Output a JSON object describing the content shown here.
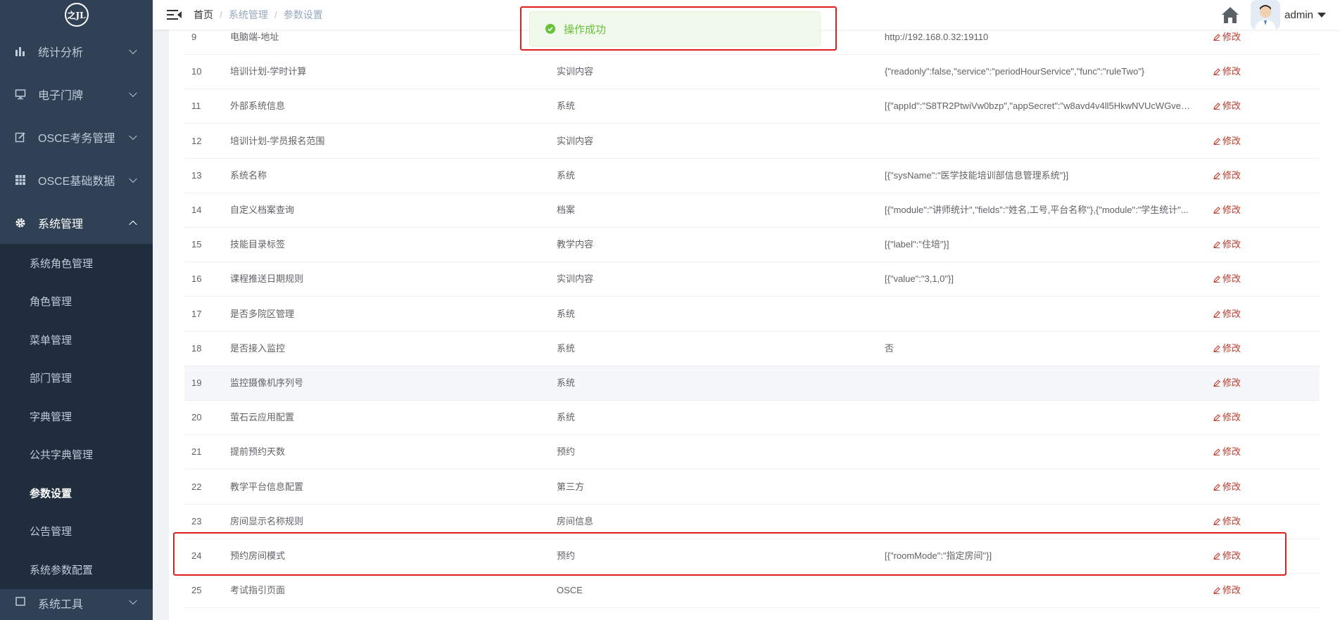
{
  "logo_text": "之JL",
  "sidebar": {
    "menus": [
      {
        "label": "统计分析",
        "icon": "bar-chart-icon",
        "expanded": false
      },
      {
        "label": "电子门牌",
        "icon": "monitor-icon",
        "expanded": false
      },
      {
        "label": "OSCE考务管理",
        "icon": "edit-form-icon",
        "expanded": false
      },
      {
        "label": "OSCE基础数据",
        "icon": "grid-table-icon",
        "expanded": false
      },
      {
        "label": "系统管理",
        "icon": "gear-icon",
        "expanded": true
      }
    ],
    "submenu": [
      {
        "label": "系统角色管理"
      },
      {
        "label": "角色管理"
      },
      {
        "label": "菜单管理"
      },
      {
        "label": "部门管理"
      },
      {
        "label": "字典管理"
      },
      {
        "label": "公共字典管理"
      },
      {
        "label": "参数设置",
        "current": true
      },
      {
        "label": "公告管理"
      },
      {
        "label": "系统参数配置"
      }
    ],
    "next_menu": {
      "label": "系统工具",
      "icon": "tool-icon"
    }
  },
  "header": {
    "breadcrumb": [
      "首页",
      "系统管理",
      "参数设置"
    ],
    "username": "admin"
  },
  "toast": {
    "text": "操作成功",
    "type": "success",
    "color": "#67c23a"
  },
  "table": {
    "edit_label": "修改",
    "rows": [
      {
        "idx": "9",
        "name": "电脑端-地址",
        "type": "",
        "value": "http://192.168.0.32:19110"
      },
      {
        "idx": "10",
        "name": "培训计划-学时计算",
        "type": "实训内容",
        "value": "{\"readonly\":false,\"service\":\"periodHourService\",\"func\":\"ruleTwo\"}"
      },
      {
        "idx": "11",
        "name": "外部系统信息",
        "type": "系统",
        "value": "[{\"appId\":\"S8TR2PtwiVw0bzp\",\"appSecret\":\"w8avd4v4ll5HkwNVUcWGveS..."
      },
      {
        "idx": "12",
        "name": "培训计划-学员报名范围",
        "type": "实训内容",
        "value": ""
      },
      {
        "idx": "13",
        "name": "系统名称",
        "type": "系统",
        "value": "[{\"sysName\":\"医学技能培训部信息管理系统\"}]"
      },
      {
        "idx": "14",
        "name": "自定义档案查询",
        "type": "档案",
        "value": "[{\"module\":\"讲师统计\",\"fields\":\"姓名,工号,平台名称\"},{\"module\":\"学生统计\"..."
      },
      {
        "idx": "15",
        "name": "技能目录标签",
        "type": "教学内容",
        "value": "[{\"label\":\"住培\"}]"
      },
      {
        "idx": "16",
        "name": "课程推送日期规则",
        "type": "实训内容",
        "value": "[{\"value\":\"3,1,0\"}]"
      },
      {
        "idx": "17",
        "name": "是否多院区管理",
        "type": "系统",
        "value": ""
      },
      {
        "idx": "18",
        "name": "是否接入监控",
        "type": "系统",
        "value": "否"
      },
      {
        "idx": "19",
        "name": "监控摄像机序列号",
        "type": "系统",
        "value": "",
        "hover": true
      },
      {
        "idx": "20",
        "name": "萤石云应用配置",
        "type": "系统",
        "value": ""
      },
      {
        "idx": "21",
        "name": "提前预约天数",
        "type": "预约",
        "value": ""
      },
      {
        "idx": "22",
        "name": "教学平台信息配置",
        "type": "第三方",
        "value": ""
      },
      {
        "idx": "23",
        "name": "房间显示名称规则",
        "type": "房间信息",
        "value": ""
      },
      {
        "idx": "24",
        "name": "预约房间模式",
        "type": "预约",
        "value": "[{\"roomMode\":\"指定房间\"}]"
      },
      {
        "idx": "25",
        "name": "考试指引页面",
        "type": "OSCE",
        "value": ""
      }
    ]
  },
  "colors": {
    "sidebar_bg": "#304156",
    "submenu_bg": "#1f2d3d",
    "edit_link": "#c0392b",
    "annotation": "#e02020"
  }
}
